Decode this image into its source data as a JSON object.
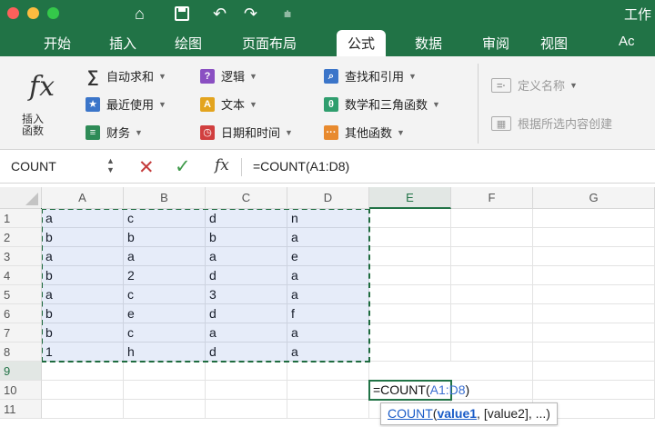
{
  "titlebar": {
    "title": "工作"
  },
  "tabs": [
    "开始",
    "插入",
    "绘图",
    "页面布局",
    "公式",
    "数据",
    "审阅",
    "视图",
    "Ac"
  ],
  "ribbon": {
    "insert_function": {
      "icon": "fx",
      "label": "插入\n函数"
    },
    "col1": [
      "自动求和",
      "最近使用",
      "财务"
    ],
    "col2": [
      "逻辑",
      "文本",
      "日期和时间"
    ],
    "col3": [
      "查找和引用",
      "数学和三角函数",
      "其他函数"
    ],
    "col4": [
      "定义名称",
      "根据所选内容创建"
    ]
  },
  "formula_bar": {
    "name_box": "COUNT",
    "fx": "fx",
    "formula": "=COUNT(A1:D8)"
  },
  "columns": [
    "A",
    "B",
    "C",
    "D",
    "E",
    "F",
    "G"
  ],
  "rows": [
    "1",
    "2",
    "3",
    "4",
    "5",
    "6",
    "7",
    "8",
    "9",
    "10",
    "11"
  ],
  "cells": [
    [
      "a",
      "c",
      "d",
      "n"
    ],
    [
      "b",
      "b",
      "b",
      "a"
    ],
    [
      "a",
      "a",
      "a",
      "e"
    ],
    [
      "b",
      "2",
      "d",
      "a"
    ],
    [
      "a",
      "c",
      "3",
      "a"
    ],
    [
      "b",
      "e",
      "d",
      "f"
    ],
    [
      "b",
      "c",
      "a",
      "a"
    ],
    [
      "1",
      "h",
      "d",
      "a"
    ]
  ],
  "active_cell": {
    "prefix": "=COUNT(",
    "ref": "A1:D8",
    "suffix": ")"
  },
  "tooltip": {
    "fn": "COUNT",
    "open": "(",
    "arg1": "value1",
    "rest": ", [value2], ...)"
  },
  "colors": {
    "ribbon_green": "#217346",
    "selection_fill": "#dfe8f7",
    "ref_blue": "#3a6fd1"
  }
}
